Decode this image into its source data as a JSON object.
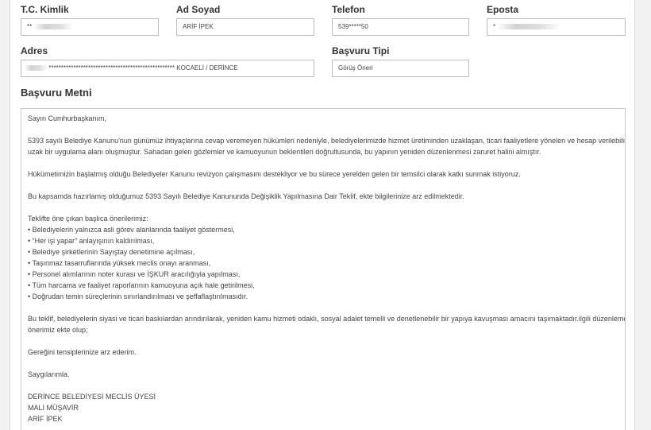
{
  "form": {
    "tc_kimlik": {
      "label": "T.C. Kimlik",
      "value": "**"
    },
    "ad_soyad": {
      "label": "Ad Soyad",
      "value": "ARİF İPEK"
    },
    "telefon": {
      "label": "Telefon",
      "value": "539*****50"
    },
    "eposta": {
      "label": "Eposta",
      "value": "*"
    },
    "adres": {
      "label": "Adres",
      "value": "*************************************************** KOCAELİ / DERİNCE"
    },
    "basvuru_tipi": {
      "label": "Başvuru Tipi",
      "value": "Görüş Öneri"
    }
  },
  "letter": {
    "title": "Başvuru Metni",
    "greeting": "Sayın Cumhurbaşkanım,",
    "p1_l1": "5393 sayılı Belediye Kanunu'nun günümüz ihtiyaçlarına cevap veremeyen hükümleri nedeniyle, belediyelerimizde hizmet üretiminden uzaklaşan, ticari faaliyetlere yönelen ve hesap verilebilirlikten",
    "p1_l2": "uzak bir uygulama alanı oluşmuştur. Sahadan gelen gözlemler ve kamuoyunun beklentileri doğrultusunda, bu yapının yeniden düzenlenmesi zaruret halini almıştır.",
    "p2": "Hükümetimizin başlatmış olduğu Belediyeler Kanunu revizyon çalışmasını destekliyor ve bu sürece yerelden gelen bir temsilci olarak katkı sunmak istiyoruz.",
    "p3": "Bu kapsamda hazırlamış olduğumuz 5393 Sayılı Belediye Kanununda Değişiklik Yapılmasına Dair Teklif, ekte bilgilerinize arz edilmektedir.",
    "list_intro": "Teklifte öne çıkan başlıca önerilerimiz:",
    "list": [
      "• Belediyelerin yalnızca asli görev alanlarında faaliyet göstermesi,",
      "• “Her işi yapar” anlayışının kaldırılması,",
      "• Belediye şirketlerinin Sayıştay denetimine açılması,",
      "• Taşınmaz tasarruflarında yüksek meclis onayı aranması,",
      "• Personel alımlarının noter kurası ve İŞKUR aracılığıyla yapılması,",
      "• Tüm harcama ve faaliyet raporlarının kamuoyuna açık hale getirilmesi,",
      "• Doğrudan temin süreçlerinin sınırlandırılması ve şeffaflaştırılmasıdır."
    ],
    "p4_l1": "Bu teklif, belediyelerin siyasi ve ticari baskılardan arındırılarak, yeniden kamu hizmeti odaklı, sosyal adalet temelli ve denetlenebilir bir yapıya kavuşması amacını taşımaktadır.ilgili düzenleme",
    "p4_l2": "önerimiz ekte olup;",
    "p5": "Gereğini tensiplerinize arz ederim.",
    "closing": "Saygılarımla.",
    "sig1": "DERİNCE BELEDİYESİ MECLİS ÜYESİ",
    "sig2": "MALİ MÜŞAVİR",
    "sig3": "ARİF İPEK"
  }
}
